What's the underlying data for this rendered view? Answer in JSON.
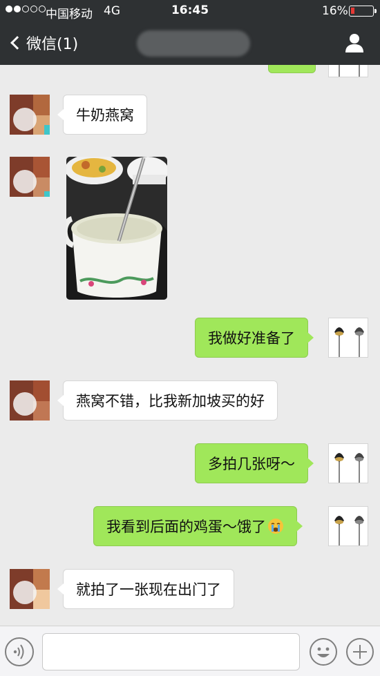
{
  "status_bar": {
    "carrier": "中国移动",
    "network": "4G",
    "time": "16:45",
    "battery_percent": "16%",
    "signal_bars_filled": 2,
    "signal_bars_total": 5,
    "battery_level": 0.16
  },
  "nav_bar": {
    "back_label": "微信(1)",
    "back_icon": "chevron-left-icon",
    "profile_icon": "person-icon"
  },
  "messages": [
    {
      "side": "in",
      "text": "牛奶燕窝"
    },
    {
      "side": "in",
      "type": "image",
      "subject": "photo"
    },
    {
      "side": "out",
      "text": "我做好准备了"
    },
    {
      "side": "in",
      "text": "燕窝不错，比我新加坡买的好"
    },
    {
      "side": "out",
      "text": "多拍几张呀～"
    },
    {
      "side": "out",
      "text": "我看到后面的鸡蛋～饿了",
      "emoji": "crying-face-emoji"
    },
    {
      "side": "in",
      "text": "就拍了一张现在出门了"
    }
  ],
  "input_bar": {
    "voice_icon": "voice-icon",
    "input_value": "",
    "emoji_icon": "smiley-icon",
    "plus_icon": "plus-icon"
  },
  "colors": {
    "bar_background": "#2e3133",
    "chat_background": "#ebebeb",
    "outgoing_bubble": "#a0e75a",
    "incoming_bubble": "#ffffff",
    "battery_low": "#e53935"
  }
}
